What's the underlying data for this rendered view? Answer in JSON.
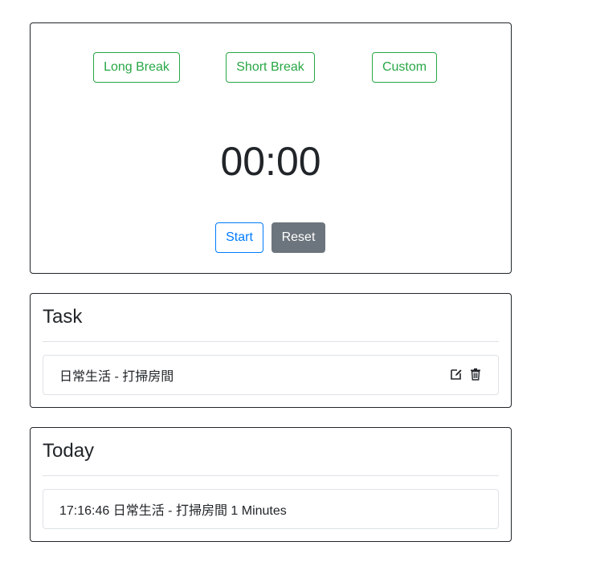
{
  "timer": {
    "modes": [
      {
        "label": "Long Break"
      },
      {
        "label": "Short Break"
      },
      {
        "label": "Custom"
      }
    ],
    "display": "00:00",
    "start_label": "Start",
    "reset_label": "Reset"
  },
  "task": {
    "title": "Task",
    "items": [
      {
        "text": "日常生活 - 打掃房間",
        "icons": [
          "edit-icon",
          "trash-icon"
        ]
      }
    ]
  },
  "today": {
    "title": "Today",
    "items": [
      {
        "text": "17:16:46 日常生活 - 打掃房間 1 Minutes"
      }
    ]
  },
  "colors": {
    "mode_accent": "#28a745",
    "start_accent": "#007bff",
    "reset_bg": "#6c757d",
    "border": "#212529",
    "divider": "#dee2e6"
  }
}
